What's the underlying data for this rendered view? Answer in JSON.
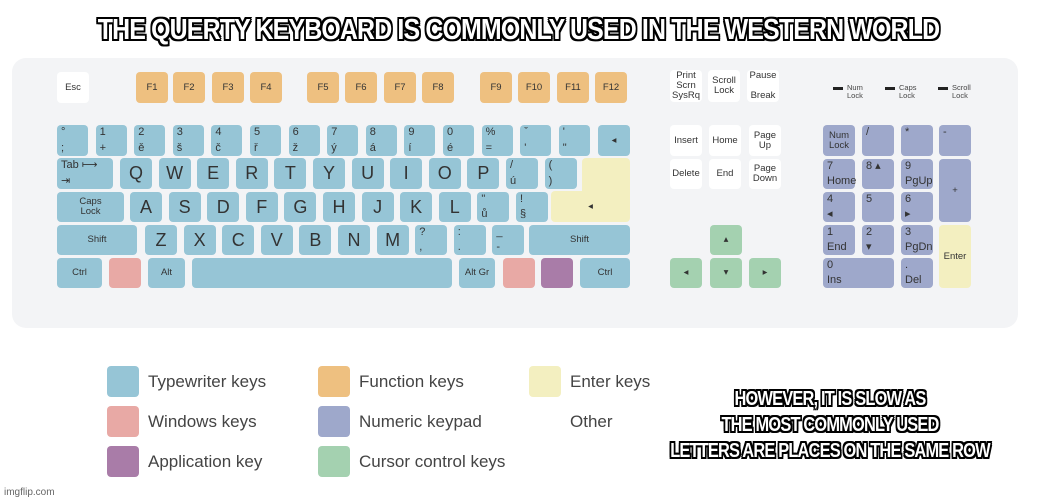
{
  "meme": {
    "top_text": "THE QUERTY KEYBOARD IS COMMONLY USED IN THE WESTERN WORLD",
    "bottom_text": "HOWEVER, IT IS SLOW AS\nTHE MOST COMMONLY USED\nLETTERS ARE PLACES ON THE SAME ROW",
    "watermark": "imgflip.com"
  },
  "colors": {
    "typewriter": "#96c5d6",
    "function": "#eec080",
    "enter": "#f3efc0",
    "windows": "#e8a9a5",
    "numeric": "#9ea8cb",
    "application": "#a97ca8",
    "cursor": "#a4d1b0"
  },
  "leds": [
    {
      "label": "Num\nLock"
    },
    {
      "label": "Caps\nLock"
    },
    {
      "label": "Scroll\nLock"
    }
  ],
  "keys": {
    "esc": {
      "c": "Esc"
    },
    "f1": {
      "c": "F1"
    },
    "f2": {
      "c": "F2"
    },
    "f3": {
      "c": "F3"
    },
    "f4": {
      "c": "F4"
    },
    "f5": {
      "c": "F5"
    },
    "f6": {
      "c": "F6"
    },
    "f7": {
      "c": "F7"
    },
    "f8": {
      "c": "F8"
    },
    "f9": {
      "c": "F9"
    },
    "f10": {
      "c": "F10"
    },
    "f11": {
      "c": "F11"
    },
    "f12": {
      "c": "F12"
    },
    "prtsc": {
      "c": "Print\nScrn\nSysRq"
    },
    "scrlk": {
      "c": "Scroll\nLock"
    },
    "pause": {
      "c": "Pause\n\nBreak"
    },
    "k_deg": {
      "t": "°",
      "b": ";"
    },
    "k1": {
      "t": "1",
      "b": "+"
    },
    "k2": {
      "t": "2",
      "b": "ě"
    },
    "k3": {
      "t": "3",
      "b": "š"
    },
    "k4": {
      "t": "4",
      "b": "č"
    },
    "k5": {
      "t": "5",
      "b": "ř"
    },
    "k6": {
      "t": "6",
      "b": "ž"
    },
    "k7": {
      "t": "7",
      "b": "ý"
    },
    "k8": {
      "t": "8",
      "b": "á"
    },
    "k9": {
      "t": "9",
      "b": "í"
    },
    "k0": {
      "t": "0",
      "b": "é"
    },
    "kpct": {
      "t": "%",
      "b": "="
    },
    "kcaron": {
      "t": "ˇ",
      "b": "'"
    },
    "kquote": {
      "t": "'",
      "b": "\""
    },
    "backspace": {
      "c": "◂"
    },
    "tab": {
      "t": "Tab   ⟼",
      "b": "           ⇥"
    },
    "q": {
      "c": "Q"
    },
    "w": {
      "c": "W"
    },
    "e": {
      "c": "E"
    },
    "r": {
      "c": "R"
    },
    "t": {
      "c": "T"
    },
    "y": {
      "c": "Y"
    },
    "u": {
      "c": "U"
    },
    "i": {
      "c": "I"
    },
    "o": {
      "c": "O"
    },
    "p": {
      "c": "P"
    },
    "kslash": {
      "t": "/",
      "b": "ú"
    },
    "kparen": {
      "t": "(",
      "b": ")"
    },
    "enter_top": {
      "c": ""
    },
    "enter": {
      "c": "◂"
    },
    "caps": {
      "c": "Caps\nLock"
    },
    "a": {
      "c": "A"
    },
    "s": {
      "c": "S"
    },
    "d": {
      "c": "D"
    },
    "f": {
      "c": "F"
    },
    "g": {
      "c": "G"
    },
    "h": {
      "c": "H"
    },
    "j": {
      "c": "J"
    },
    "k": {
      "c": "K"
    },
    "l": {
      "c": "L"
    },
    "kdq": {
      "t": "\"",
      "b": "ů"
    },
    "kexcl": {
      "t": "!",
      "b": "§"
    },
    "lshift": {
      "c": "Shift"
    },
    "z": {
      "c": "Z"
    },
    "x": {
      "c": "X"
    },
    "cc": {
      "c": "C"
    },
    "v": {
      "c": "V"
    },
    "b": {
      "c": "B"
    },
    "n": {
      "c": "N"
    },
    "m": {
      "c": "M"
    },
    "kq": {
      "t": "?",
      "b": ","
    },
    "kcolon": {
      "t": ":",
      "b": "."
    },
    "kunder": {
      "t": "_",
      "b": "-"
    },
    "rshift": {
      "c": "Shift"
    },
    "lctrl": {
      "c": "Ctrl"
    },
    "lwin": {
      "c": ""
    },
    "alt": {
      "c": "Alt"
    },
    "space": {
      "c": ""
    },
    "altgr": {
      "c": "Alt Gr"
    },
    "rwin": {
      "c": ""
    },
    "menu": {
      "c": ""
    },
    "rctrl": {
      "c": "Ctrl"
    },
    "insert": {
      "c": "Insert"
    },
    "home": {
      "c": "Home"
    },
    "pgup": {
      "c": "Page\nUp"
    },
    "delete": {
      "c": "Delete"
    },
    "end": {
      "c": "End"
    },
    "pgdn": {
      "c": "Page\nDown"
    },
    "up": {
      "c": "▴"
    },
    "left": {
      "c": "◂"
    },
    "down": {
      "c": "▾"
    },
    "right": {
      "c": "▸"
    },
    "numlock": {
      "c": "Num\nLock"
    },
    "ndiv": {
      "t": "/"
    },
    "nmul": {
      "t": "*"
    },
    "nsub": {
      "t": "-"
    },
    "n7": {
      "t": "7",
      "b": "Home"
    },
    "n8": {
      "t": "8 ▴"
    },
    "n9": {
      "t": "9",
      "b": "PgUp"
    },
    "nadd": {
      "c": "+"
    },
    "n4": {
      "t": "4",
      "b": " ◂"
    },
    "n5": {
      "t": "5"
    },
    "n6": {
      "t": "6",
      "b": "       ▸"
    },
    "n1": {
      "t": "1",
      "b": "End"
    },
    "n2": {
      "t": "2",
      "b": "       ▾"
    },
    "n3": {
      "t": "3",
      "b": "PgDn"
    },
    "nenter": {
      "c": "Enter"
    },
    "n0": {
      "t": "0",
      "b": "Ins"
    },
    "ndel": {
      "t": ".",
      "b": "Del"
    }
  },
  "legend": [
    {
      "label": "Typewriter keys",
      "color": "#96c5d6"
    },
    {
      "label": "Function keys",
      "color": "#eec080"
    },
    {
      "label": "Enter keys",
      "color": "#f3efc0"
    },
    {
      "label": "Windows keys",
      "color": "#e8a9a5"
    },
    {
      "label": "Numeric keypad",
      "color": "#9ea8cb"
    },
    {
      "label": "Other",
      "color": "#ffffff"
    },
    {
      "label": "Application key",
      "color": "#a97ca8"
    },
    {
      "label": "Cursor control keys",
      "color": "#a4d1b0"
    }
  ]
}
